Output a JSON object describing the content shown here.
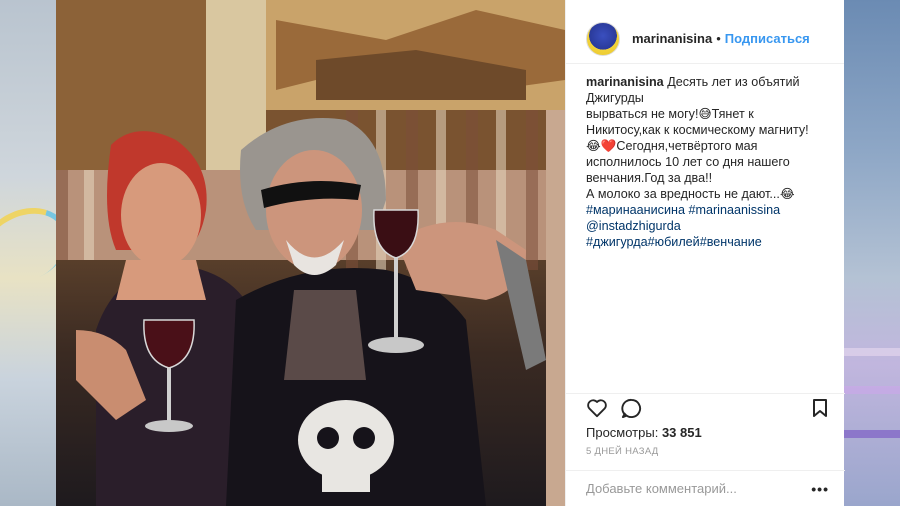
{
  "post": {
    "username": "marinanisina",
    "dot": "•",
    "follow_label": "Подписаться"
  },
  "caption": {
    "author": "marinanisina",
    "lines": [
      "Десять лет из объятий",
      "Джигурды",
      "вырваться не могу!😅Тянет к",
      "Никитосу,как к космическому магниту!",
      "😂❤️Сегодня,четвёртого мая",
      "исполнилось 10 лет со дня нашего",
      "венчания.Год за два!!",
      "А молоко за вредность не дают...😂"
    ],
    "hashtags_1": "#маринаанисина #marinaanissina",
    "mention": "@instadzhigurda",
    "hashtags_2": "#джигурда#юбилей#венчание"
  },
  "actions": {
    "like_icon": "heart-icon",
    "comment_icon": "speech-bubble-icon",
    "save_icon": "bookmark-icon"
  },
  "stats": {
    "views_label": "Просмотры:",
    "views_count": "33 851",
    "time_ago": "5 ДНЕЙ НАЗАД"
  },
  "comment_bar": {
    "placeholder": "Добавьте комментарий...",
    "more_icon": "more-horizontal-icon",
    "more_text": "•••"
  }
}
